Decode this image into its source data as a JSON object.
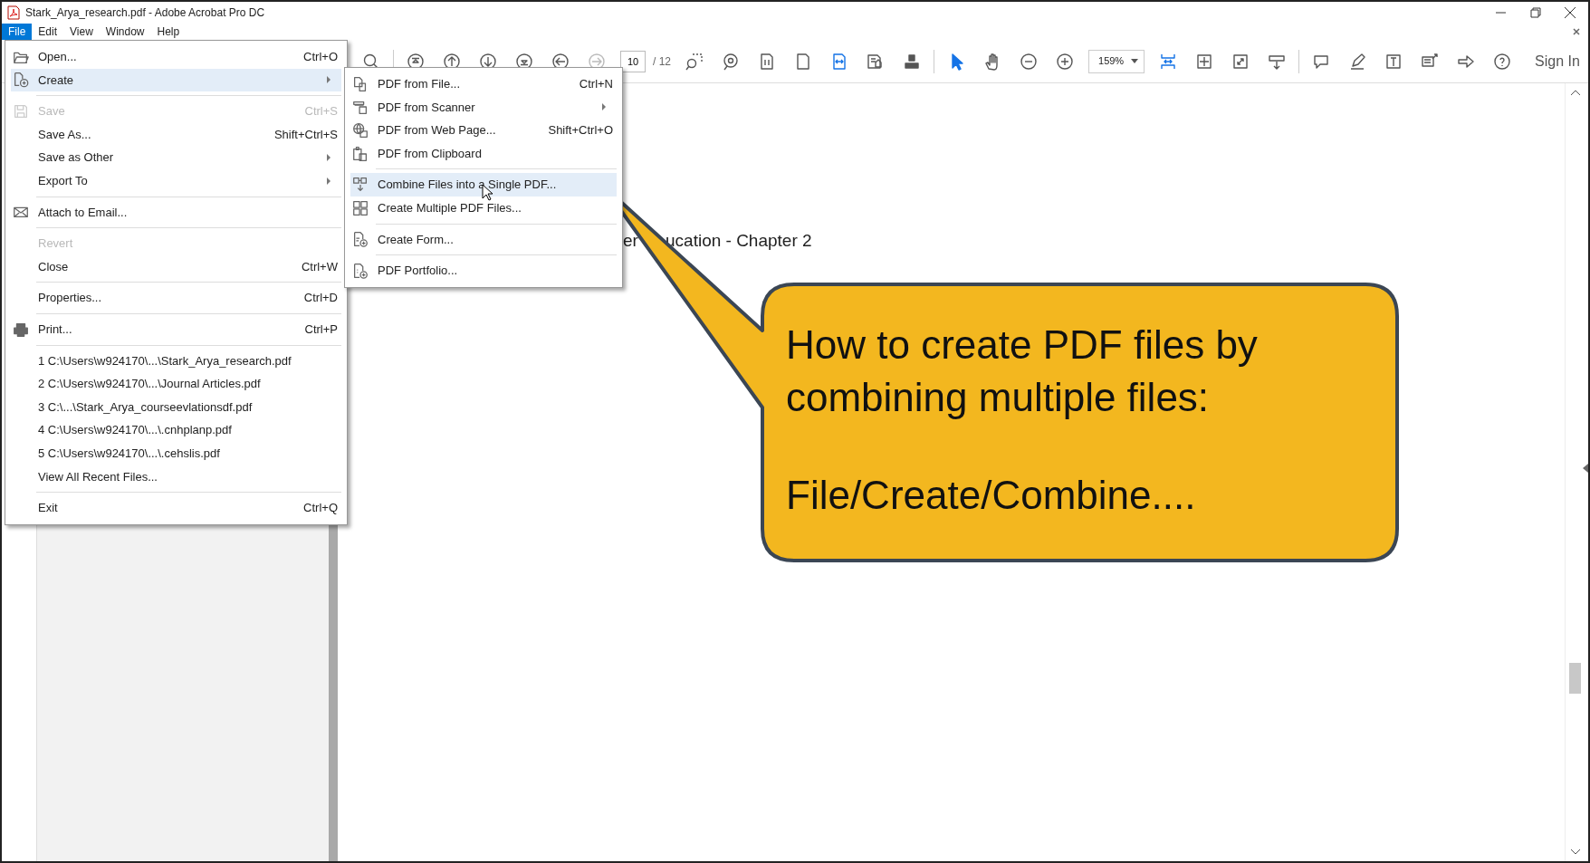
{
  "window": {
    "title": "Stark_Arya_research.pdf - Adobe Acrobat Pro DC"
  },
  "menu_bar": [
    {
      "label": "File",
      "selected": true
    },
    {
      "label": "Edit",
      "selected": false
    },
    {
      "label": "View",
      "selected": false
    },
    {
      "label": "Window",
      "selected": false
    },
    {
      "label": "Help",
      "selected": false
    }
  ],
  "toolbar": {
    "page_number": "10",
    "page_count": "/ 12",
    "zoom": "159%",
    "sign_in": "Sign In"
  },
  "document": {
    "heading_parts": [
      "er",
      "ucation - Chapter 2"
    ]
  },
  "file_menu": [
    {
      "label": "Open...",
      "shortcut": "Ctrl+O",
      "disabled": false,
      "selected": false,
      "submenu": false,
      "separator_before": false
    },
    {
      "label": "Create",
      "disabled": false,
      "selected": true,
      "submenu": true,
      "separator_before": false
    },
    {
      "label": "Save",
      "shortcut": "Ctrl+S",
      "disabled": true,
      "selected": false,
      "submenu": false,
      "separator_before": true
    },
    {
      "label": "Save As...",
      "shortcut": "Shift+Ctrl+S",
      "disabled": false,
      "selected": false,
      "submenu": false,
      "separator_before": false
    },
    {
      "label": "Save as Other",
      "disabled": false,
      "selected": false,
      "submenu": true,
      "separator_before": false
    },
    {
      "label": "Export To",
      "disabled": false,
      "selected": false,
      "submenu": true,
      "separator_before": false
    },
    {
      "label": "Attach to Email...",
      "disabled": false,
      "selected": false,
      "submenu": false,
      "separator_before": true
    },
    {
      "label": "Revert",
      "disabled": true,
      "selected": false,
      "submenu": false,
      "separator_before": true
    },
    {
      "label": "Close",
      "shortcut": "Ctrl+W",
      "disabled": false,
      "selected": false,
      "submenu": false,
      "separator_before": false
    },
    {
      "label": "Properties...",
      "shortcut": "Ctrl+D",
      "disabled": false,
      "selected": false,
      "submenu": false,
      "separator_before": true
    },
    {
      "label": "Print...",
      "shortcut": "Ctrl+P",
      "disabled": false,
      "selected": false,
      "submenu": false,
      "separator_before": true
    },
    {
      "label": "1 C:\\Users\\w924170\\...\\Stark_Arya_research.pdf",
      "disabled": false,
      "selected": false,
      "submenu": false,
      "separator_before": true
    },
    {
      "label": "2 C:\\Users\\w924170\\...\\Journal Articles.pdf",
      "disabled": false,
      "selected": false,
      "submenu": false,
      "separator_before": false
    },
    {
      "label": "3 C:\\...\\Stark_Arya_courseevlationsdf.pdf",
      "disabled": false,
      "selected": false,
      "submenu": false,
      "separator_before": false
    },
    {
      "label": "4 C:\\Users\\w924170\\...\\.cnhplanp.pdf",
      "disabled": false,
      "selected": false,
      "submenu": false,
      "separator_before": false
    },
    {
      "label": "5 C:\\Users\\w924170\\...\\.cehslis.pdf",
      "disabled": false,
      "selected": false,
      "submenu": false,
      "separator_before": false
    },
    {
      "label": "View All Recent Files...",
      "disabled": false,
      "selected": false,
      "submenu": false,
      "separator_before": false
    },
    {
      "label": "Exit",
      "shortcut": "Ctrl+Q",
      "disabled": false,
      "selected": false,
      "submenu": false,
      "separator_before": true
    }
  ],
  "create_submenu": [
    {
      "label": "PDF from File...",
      "shortcut": "Ctrl+N",
      "selected": false,
      "submenu": false,
      "separator_before": false
    },
    {
      "label": "PDF from Scanner",
      "selected": false,
      "submenu": true,
      "separator_before": false
    },
    {
      "label": "PDF from Web Page...",
      "shortcut": "Shift+Ctrl+O",
      "selected": false,
      "submenu": false,
      "separator_before": false
    },
    {
      "label": "PDF from Clipboard",
      "selected": false,
      "submenu": false,
      "separator_before": false
    },
    {
      "label": "Combine Files into a Single PDF...",
      "selected": true,
      "submenu": false,
      "separator_before": true
    },
    {
      "label": "Create Multiple PDF Files...",
      "selected": false,
      "submenu": false,
      "separator_before": false
    },
    {
      "label": "Create Form...",
      "selected": false,
      "submenu": false,
      "separator_before": true
    },
    {
      "label": "PDF Portfolio...",
      "selected": false,
      "submenu": false,
      "separator_before": true
    }
  ],
  "callout": {
    "heading": "How to create PDF files by combining multiple files:",
    "path": "File/Create/Combine...."
  }
}
